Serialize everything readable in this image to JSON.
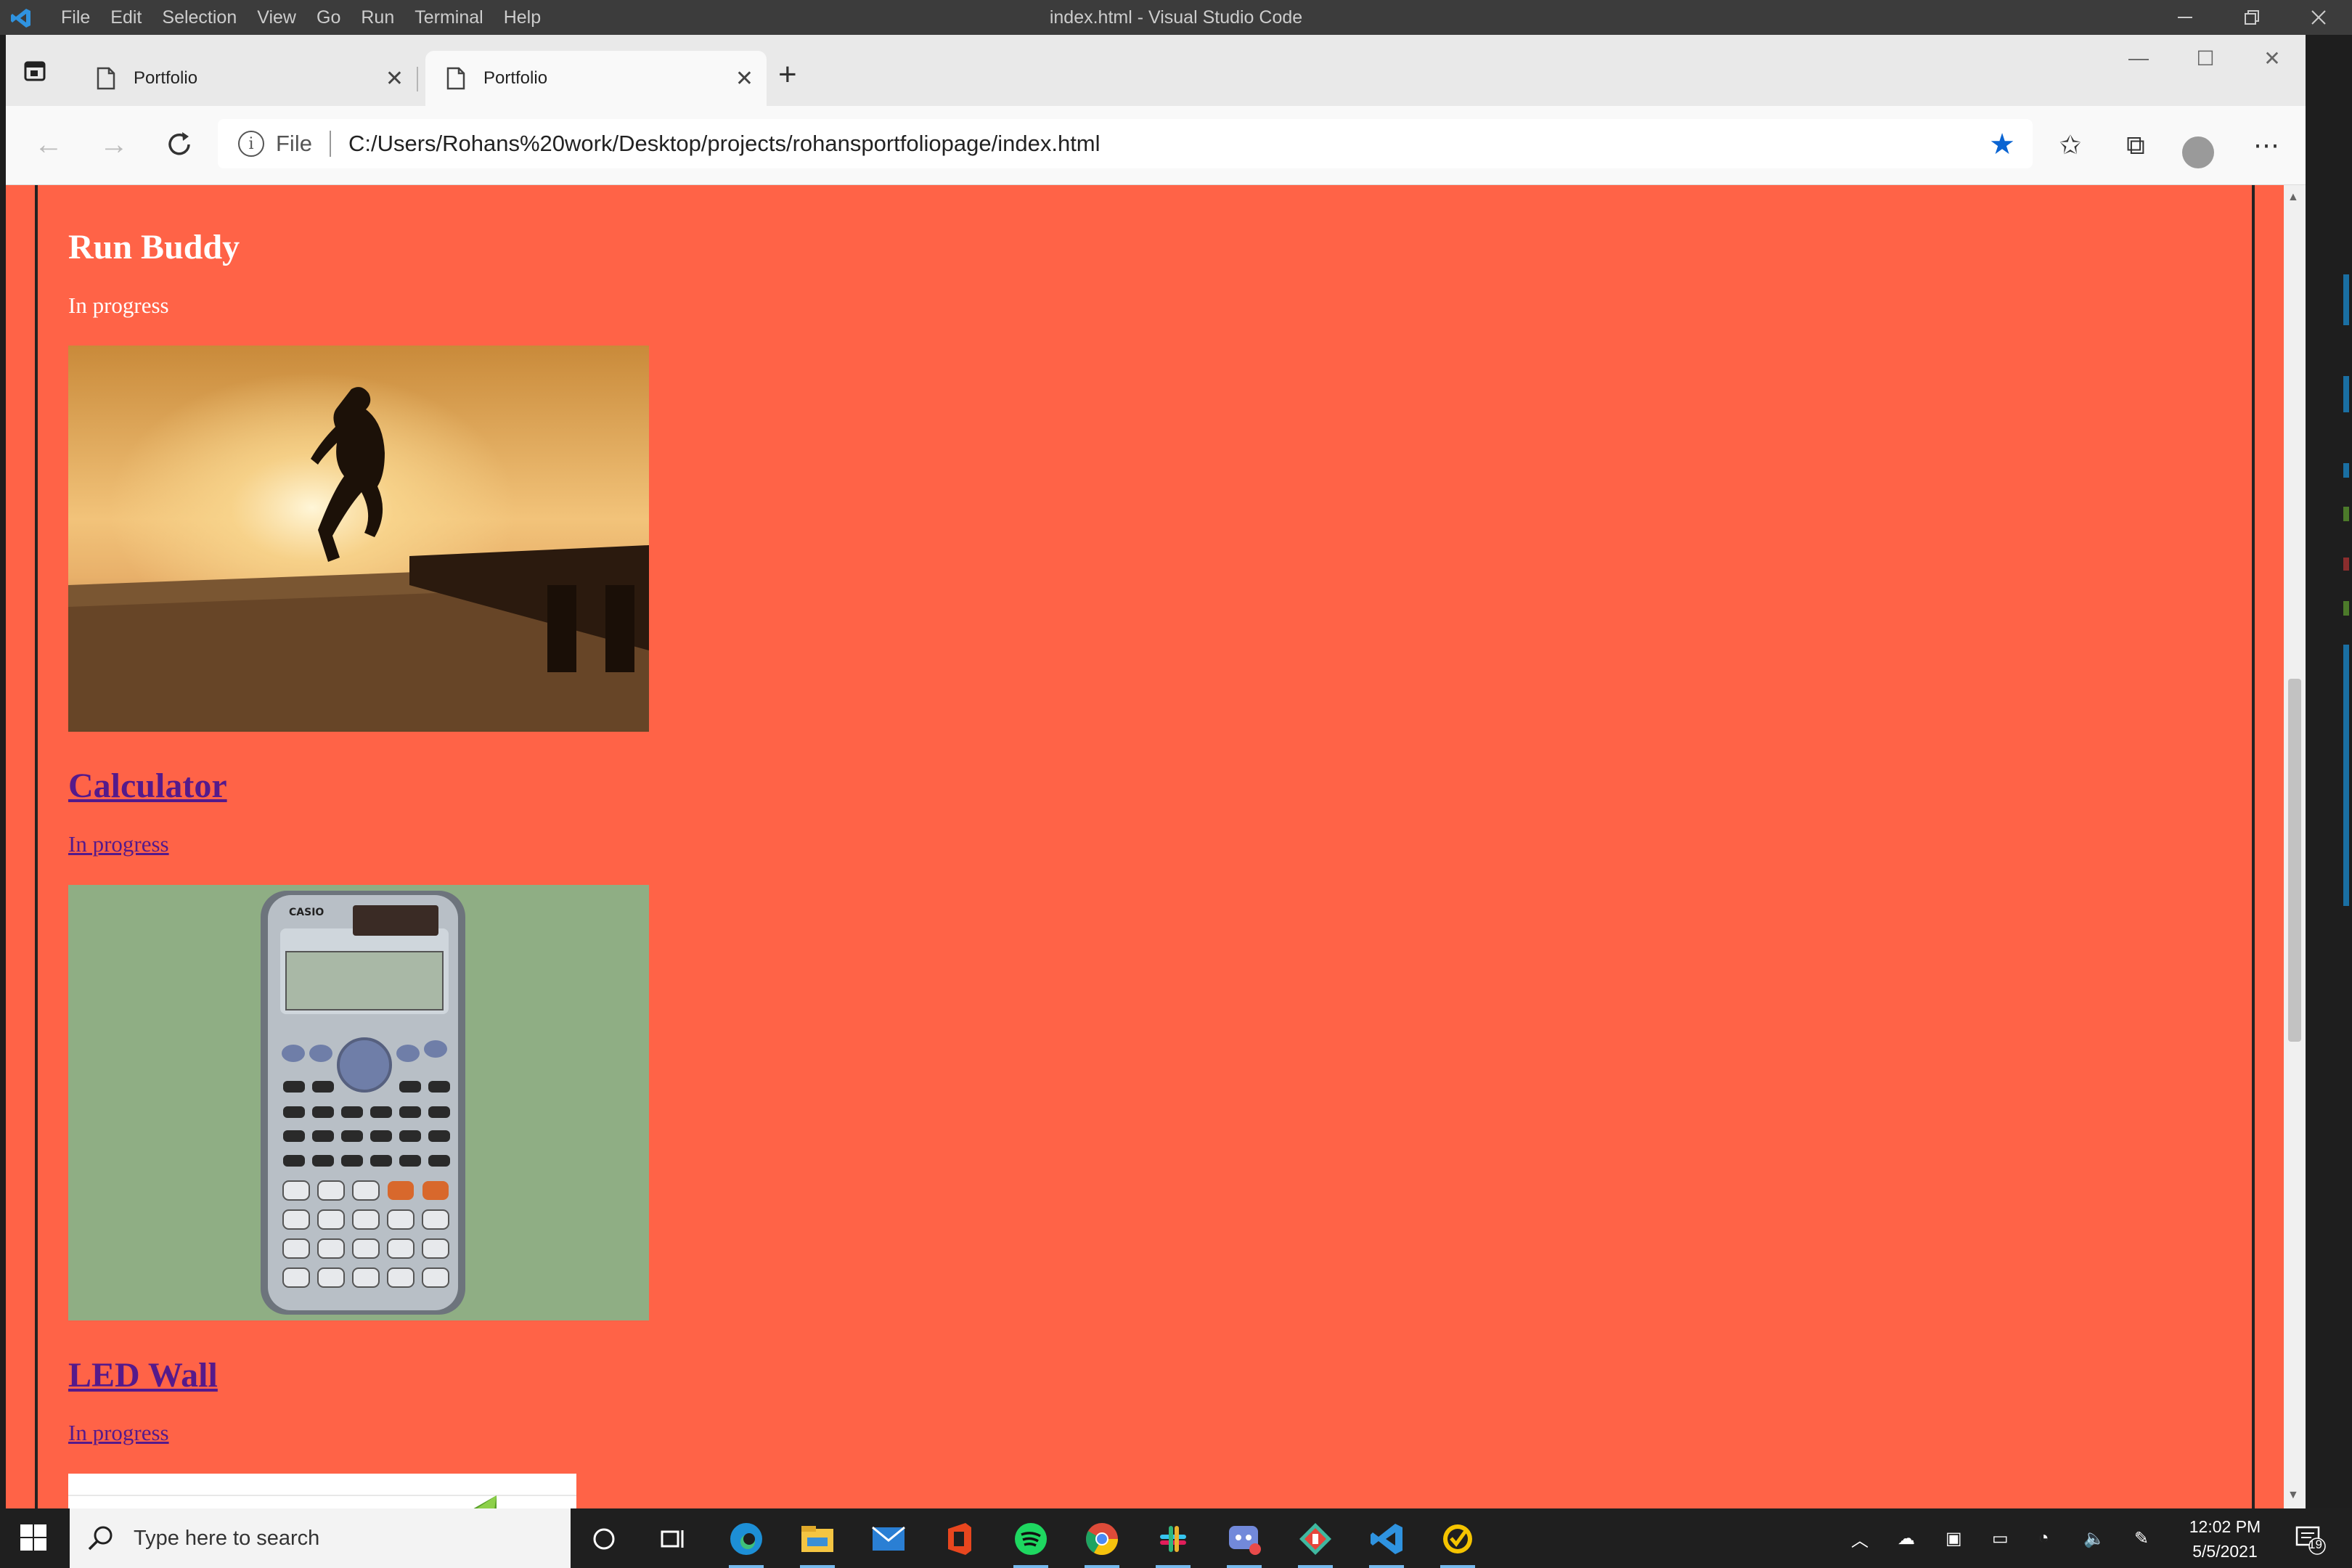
{
  "vscode": {
    "menu": [
      "File",
      "Edit",
      "Selection",
      "View",
      "Go",
      "Run",
      "Terminal",
      "Help"
    ],
    "window_title": "index.html - Visual Studio Code"
  },
  "browser": {
    "tabs": [
      {
        "label": "Portfolio",
        "active": false
      },
      {
        "label": "Portfolio",
        "active": true
      }
    ],
    "address": {
      "scheme_label": "File",
      "url": "C:/Users/Rohans%20work/Desktop/projects/rohansportfoliopage/index.html"
    }
  },
  "page": {
    "background": "#ff6347",
    "projects": [
      {
        "title": "Run Buddy",
        "status": "In progress",
        "image": "runner-at-sunset",
        "linked": false
      },
      {
        "title": "Calculator",
        "status": "In progress",
        "image": "casio-calculator",
        "linked": true
      },
      {
        "title": "LED Wall",
        "status": "In progress",
        "image": "led-wall-preview",
        "linked": true
      }
    ]
  },
  "taskbar": {
    "search_placeholder": "Type here to search",
    "time": "12:02 PM",
    "date": "5/5/2021",
    "notification_count": "19",
    "apps": [
      "task-view",
      "edge",
      "file-explorer",
      "mail",
      "office",
      "spotify",
      "chrome",
      "slack",
      "discord",
      "git-tool",
      "vscode",
      "norton"
    ]
  }
}
